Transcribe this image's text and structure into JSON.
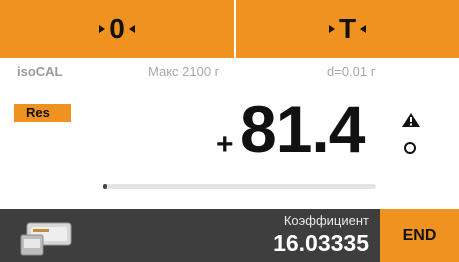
{
  "top": {
    "zero_label": "0",
    "tare_label": "T"
  },
  "info": {
    "method": "isoCAL",
    "max": "Макс 2100 г",
    "d": "d=0.01 г"
  },
  "display": {
    "mode_badge": "Res",
    "sign": "+",
    "value": "81.4"
  },
  "progress": {
    "fraction": 0.01
  },
  "bottom": {
    "coef_label": "Коэффициент",
    "coef_value": "16.03335",
    "end_label": "END"
  },
  "colors": {
    "accent": "#f0921f",
    "bottom_bar": "#3e3e3e"
  },
  "icons": [
    "triangle-right-icon",
    "triangle-left-icon",
    "warning-icon",
    "stability-circle-icon",
    "app-icon"
  ]
}
